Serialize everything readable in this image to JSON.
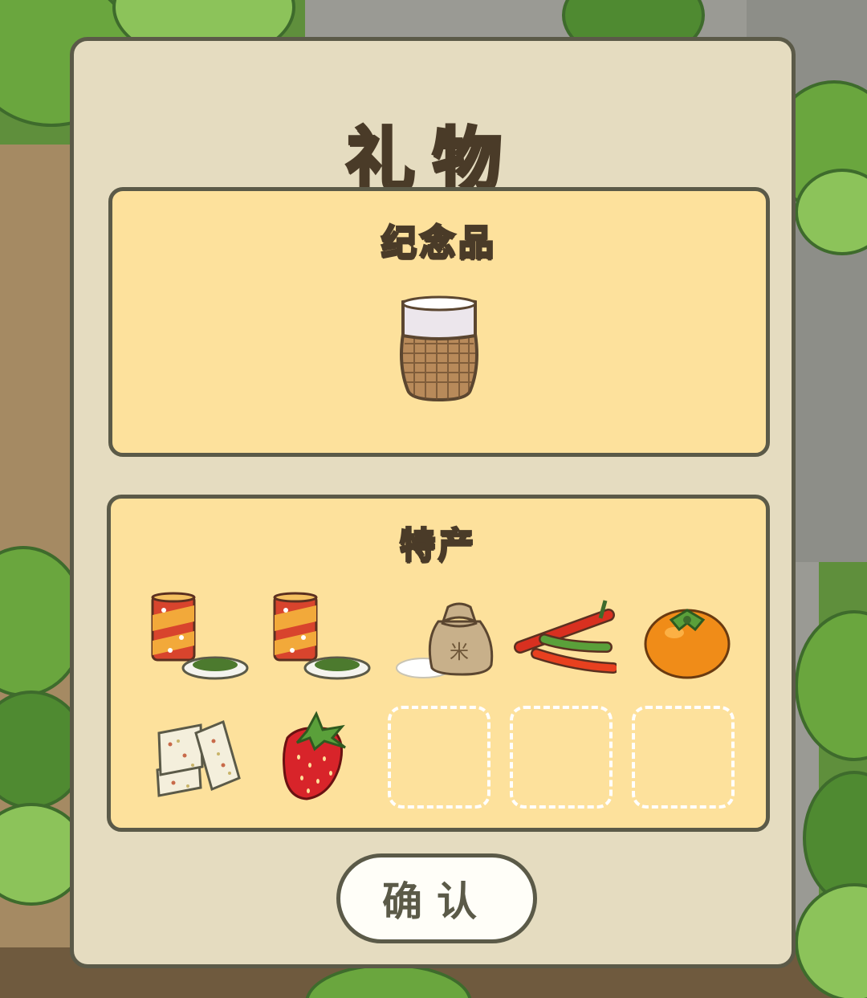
{
  "dialog": {
    "title": "礼物",
    "souvenir": {
      "title": "纪念品",
      "items": [
        {
          "name": "woven-cup"
        }
      ]
    },
    "specialty": {
      "title": "特产",
      "items": [
        {
          "name": "tea-can"
        },
        {
          "name": "tea-can"
        },
        {
          "name": "rice-bag",
          "bag_text": "米"
        },
        {
          "name": "chili-peppers"
        },
        {
          "name": "persimmon"
        },
        {
          "name": "nougat"
        },
        {
          "name": "strawberry"
        }
      ],
      "empty_slots": 3
    },
    "confirm_label": "确认"
  }
}
